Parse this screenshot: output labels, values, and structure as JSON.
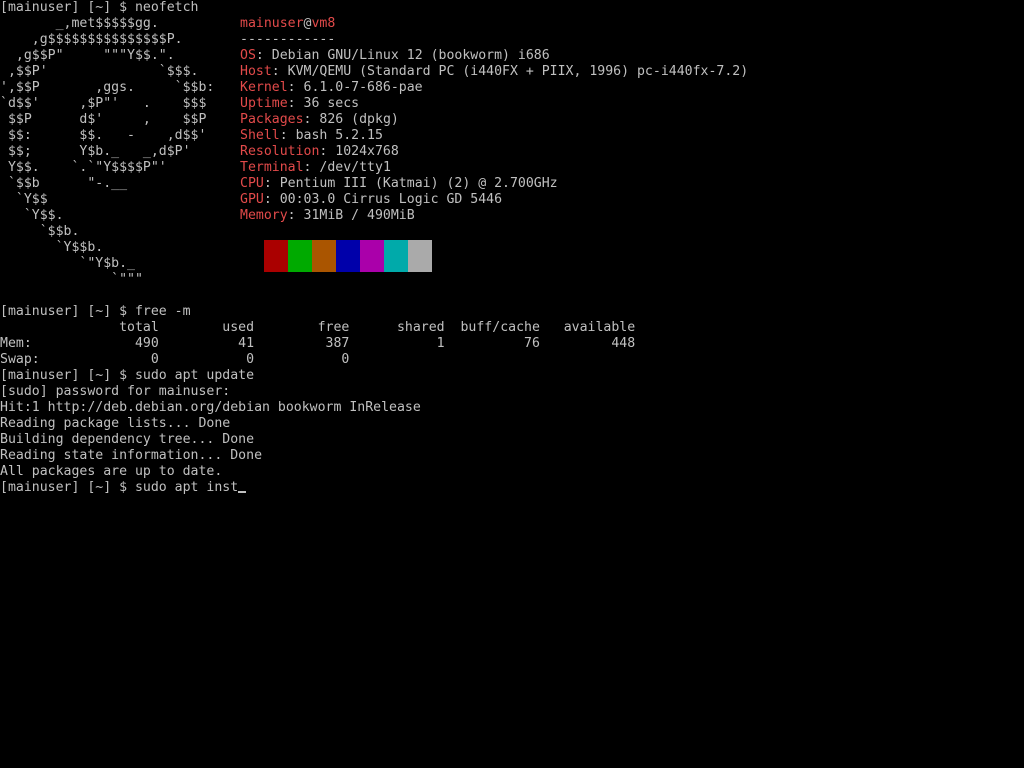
{
  "colors": {
    "background": "#000000",
    "foreground": "#c0c0c0",
    "accent_red": "#e24a4a"
  },
  "neofetch": {
    "prompt": "[mainuser] [~] $ neofetch",
    "user": "mainuser",
    "at": "@",
    "host": "vm8",
    "separator": "------------",
    "logo": [
      "       _,met$$$$$gg.",
      "    ,g$$$$$$$$$$$$$$$P.",
      "  ,g$$P\"     \"\"\"Y$$.\".",
      " ,$$P'              `$$$.",
      "',$$P       ,ggs.     `$$b:",
      "`d$$'     ,$P\"'   .    $$$",
      " $$P      d$'     ,    $$P",
      " $$:      $$.   -    ,d$$'",
      " $$;      Y$b._   _,d$P'",
      " Y$$.    `.`\"Y$$$$P\"'",
      " `$$b      \"-.__",
      "  `Y$$",
      "   `Y$$.",
      "     `$$b.",
      "       `Y$$b.",
      "          `\"Y$b._",
      "              `\"\"\""
    ],
    "info": [
      {
        "key": "OS",
        "value": "Debian GNU/Linux 12 (bookworm) i686"
      },
      {
        "key": "Host",
        "value": "KVM/QEMU (Standard PC (i440FX + PIIX, 1996) pc-i440fx-7.2)"
      },
      {
        "key": "Kernel",
        "value": "6.1.0-7-686-pae"
      },
      {
        "key": "Uptime",
        "value": "36 secs"
      },
      {
        "key": "Packages",
        "value": "826 (dpkg)"
      },
      {
        "key": "Shell",
        "value": "bash 5.2.15"
      },
      {
        "key": "Resolution",
        "value": "1024x768"
      },
      {
        "key": "Terminal",
        "value": "/dev/tty1"
      },
      {
        "key": "CPU",
        "value": "Pentium III (Katmai) (2) @ 2.700GHz"
      },
      {
        "key": "GPU",
        "value": "00:03.0 Cirrus Logic GD 5446"
      },
      {
        "key": "Memory",
        "value": "31MiB / 490MiB"
      }
    ],
    "palette": [
      "#000000",
      "#aa0000",
      "#00aa00",
      "#aa5500",
      "#0000aa",
      "#aa00aa",
      "#00aaaa",
      "#aaaaaa"
    ]
  },
  "free_cmd": {
    "prompt": "[mainuser] [~] $ free -m",
    "header": "               total        used        free      shared  buff/cache   available",
    "mem": "Mem:             490          41         387           1          76         448",
    "swap": "Swap:              0           0           0"
  },
  "apt_update": {
    "prompt": "[mainuser] [~] $ sudo apt update",
    "lines": [
      "[sudo] password for mainuser:",
      "Hit:1 http://deb.debian.org/debian bookworm InRelease",
      "Reading package lists... Done",
      "Building dependency tree... Done",
      "Reading state information... Done",
      "All packages are up to date."
    ]
  },
  "current_prompt": {
    "text": "[mainuser] [~] $ sudo apt inst"
  }
}
